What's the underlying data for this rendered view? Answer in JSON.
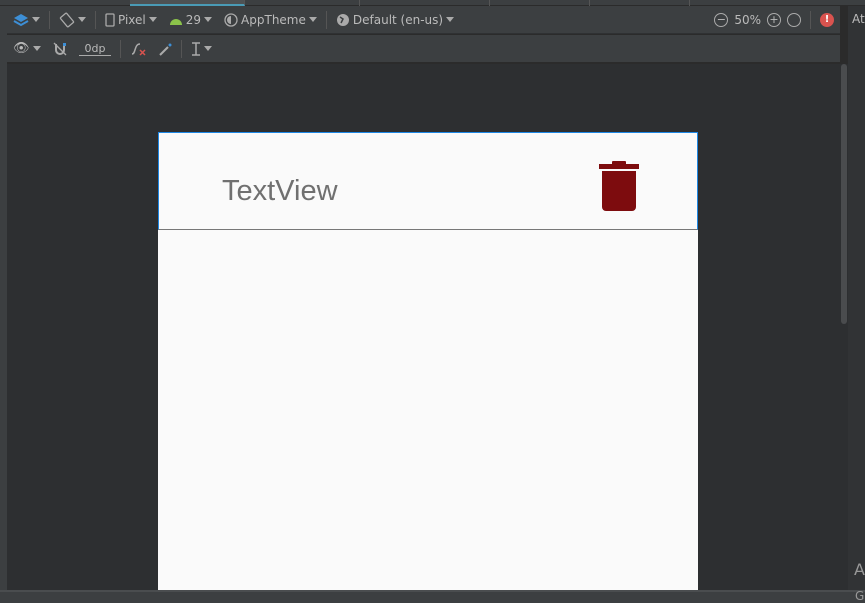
{
  "toolbar": {
    "device": "Pixel",
    "api": "29",
    "theme": "AppTheme",
    "locale": "Default (en-us)",
    "zoom": "50%",
    "margin": "0dp"
  },
  "preview": {
    "text": "TextView"
  },
  "right_panel": {
    "label_a": "At",
    "label_g": "G"
  },
  "colors": {
    "accent": "#1e88e5",
    "trash": "#7d0c0e",
    "error": "#d9534f"
  }
}
